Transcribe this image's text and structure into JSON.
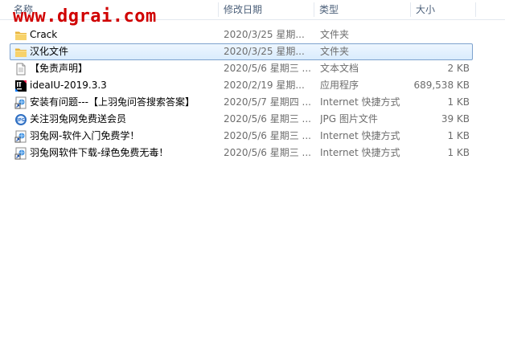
{
  "watermark": "www.dgrai.com",
  "columns": {
    "name": "名称",
    "date": "修改日期",
    "type": "类型",
    "size": "大小"
  },
  "files": [
    {
      "name": "Crack",
      "date": "2020/3/25 星期...",
      "type": "文件夹",
      "size": "",
      "icon": "folder-icon"
    },
    {
      "name": "汉化文件",
      "date": "2020/3/25 星期...",
      "type": "文件夹",
      "size": "",
      "icon": "folder-icon",
      "selected": true
    },
    {
      "name": "【免责声明】",
      "date": "2020/5/6 星期三 ...",
      "type": "文本文档",
      "size": "2 KB",
      "icon": "text-document-icon"
    },
    {
      "name": "ideaIU-2019.3.3",
      "date": "2020/2/19 星期...",
      "type": "应用程序",
      "size": "689,538 KB",
      "icon": "intellij-app-icon"
    },
    {
      "name": "安装有问题---【上羽兔问答搜索答案】",
      "date": "2020/5/7 星期四 ...",
      "type": "Internet 快捷方式",
      "size": "1 KB",
      "icon": "internet-shortcut-icon"
    },
    {
      "name": "关注羽兔网免费送会员",
      "date": "2020/5/6 星期三 ...",
      "type": "JPG 图片文件",
      "size": "39 KB",
      "icon": "jpg-image-icon"
    },
    {
      "name": "羽兔网-软件入门免费学！",
      "date": "2020/5/6 星期三 ...",
      "type": "Internet 快捷方式",
      "size": "1 KB",
      "icon": "internet-shortcut-icon"
    },
    {
      "name": "羽兔网软件下载-绿色免费无毒！",
      "date": "2020/5/6 星期三 ...",
      "type": "Internet 快捷方式",
      "size": "1 KB",
      "icon": "internet-shortcut-icon"
    }
  ],
  "colors": {
    "selection": "#cce8ff",
    "selection_border": "#7da2ce",
    "header_text": "#4c607a",
    "watermark": "#d00000"
  }
}
